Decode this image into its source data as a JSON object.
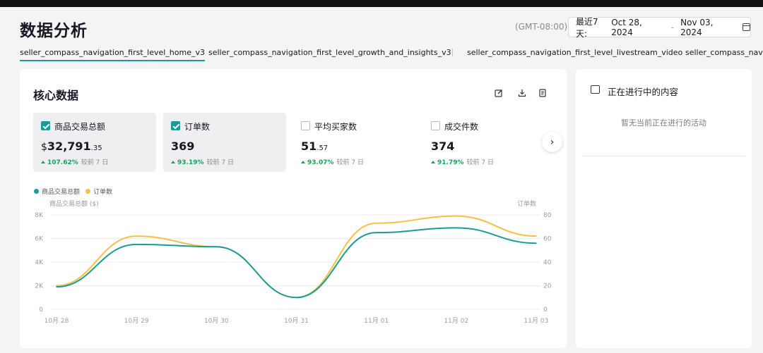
{
  "header": {
    "title": "数据分析",
    "timezone": "(GMT-08:00)",
    "date_range_prefix": "最近7天:",
    "date_start": "Oct 28, 2024",
    "date_sep": "-",
    "date_end": "Nov 03, 2024"
  },
  "tabs": [
    {
      "label": "seller_compass_navigation_first_level_home_v3",
      "active": true
    },
    {
      "label": "seller_compass_navigation_first_level_growth_and_insights_v3",
      "active": false
    },
    {
      "label": "seller_compass_navigation_first_level_livestream_video",
      "active": false
    },
    {
      "label": "seller_compass_navigation_first_level_product",
      "active": false
    }
  ],
  "core": {
    "title": "核心数据",
    "metrics": [
      {
        "label": "商品交易总额",
        "checked": true,
        "currency": "$",
        "value": "32,791",
        "decimal": ".35",
        "change": "107.62%",
        "compare": "较前 7 日"
      },
      {
        "label": "订单数",
        "checked": true,
        "currency": "",
        "value": "369",
        "decimal": "",
        "change": "93.19%",
        "compare": "较前 7 日"
      },
      {
        "label": "平均买家数",
        "checked": false,
        "currency": "",
        "value": "51",
        "decimal": ".57",
        "change": "93.07%",
        "compare": "较前 7 日"
      },
      {
        "label": "成交件数",
        "checked": false,
        "currency": "",
        "value": "374",
        "decimal": "",
        "change": "91.79%",
        "compare": "较前 7 日"
      }
    ],
    "next_icon": "chevron-right-icon"
  },
  "chart_data": {
    "type": "line",
    "categories": [
      "10月 28",
      "10月 29",
      "10月 30",
      "10月 31",
      "11月 01",
      "11月 02",
      "11月 03"
    ],
    "series": [
      {
        "name": "商品交易总额",
        "axis": "left",
        "color": "#1a9c96",
        "values": [
          1900,
          5500,
          5300,
          1000,
          6500,
          6900,
          5600
        ]
      },
      {
        "name": "订单数",
        "axis": "right",
        "color": "#f7c045",
        "values": [
          20,
          62,
          53,
          10,
          73,
          79,
          62
        ]
      }
    ],
    "ylabel": "商品交易总额 ($)",
    "ylabel_right": "订单数",
    "ylim": [
      0,
      8000
    ],
    "ylim_right": [
      0,
      80
    ],
    "yticks": [
      "0",
      "2K",
      "4K",
      "6K",
      "8K"
    ],
    "yticks_right": [
      "0",
      "20",
      "40",
      "60",
      "80"
    ],
    "grid": true,
    "legend": "top-left"
  },
  "side": {
    "title": "正在进行中的内容",
    "empty_text": "暂无当前正在进行的活动"
  }
}
